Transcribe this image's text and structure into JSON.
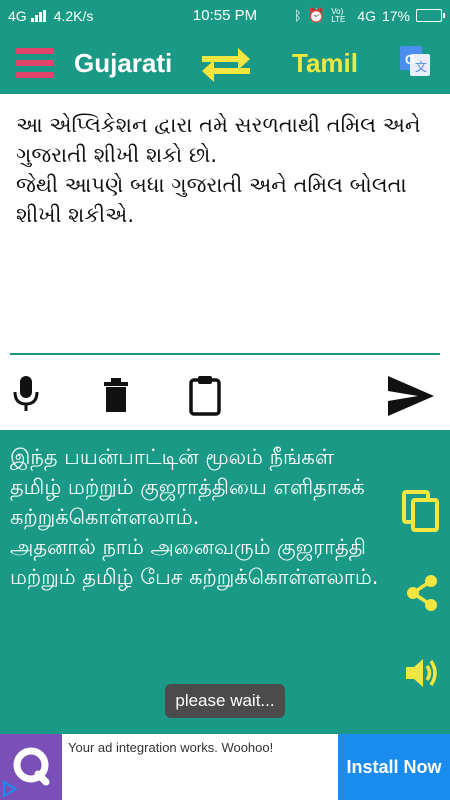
{
  "status_bar": {
    "network": "4G",
    "speed": "4.2K/s",
    "time": "10:55 PM",
    "battery": "17%",
    "volte": "Vo) LTE",
    "network_right": "4G"
  },
  "app_bar": {
    "source_language": "Gujarati",
    "target_language": "Tamil",
    "icons": [
      "menu-icon",
      "swap-arrows-icon",
      "google-translate-icon"
    ]
  },
  "input": {
    "text": "આ એપ્લિકેશન દ્વારા તમે સરળતાથી તમિલ અને ગુજરાતી શીખી શકો છો.\nજેથી આપણે બધા ગુજરાતી અને તમિલ બોલતા શીખી શકીએ."
  },
  "toolbar": {
    "icons": [
      "microphone-icon",
      "trash-icon",
      "clipboard-icon",
      "send-icon"
    ]
  },
  "output": {
    "text": "இந்த பயன்பாட்டின் மூலம் நீங்கள் தமிழ் மற்றும் குஜராத்தியை எளிதாகக் கற்றுக்கொள்ளலாம்.\nஅதனால் நாம் அனைவரும் குஜராத்தி மற்றும் தமிழ் பேச கற்றுக்கொள்ளலாம்.",
    "icons": [
      "copy-icon",
      "share-icon",
      "speaker-icon"
    ],
    "toast": "please wait..."
  },
  "ad": {
    "message": "Your ad integration works. Woohoo!",
    "button": "Install Now"
  },
  "colors": {
    "primary": "#1a9a86",
    "menu_accent": "#e0446b",
    "highlight": "#f2e640",
    "ad_button": "#1a8cf0"
  }
}
